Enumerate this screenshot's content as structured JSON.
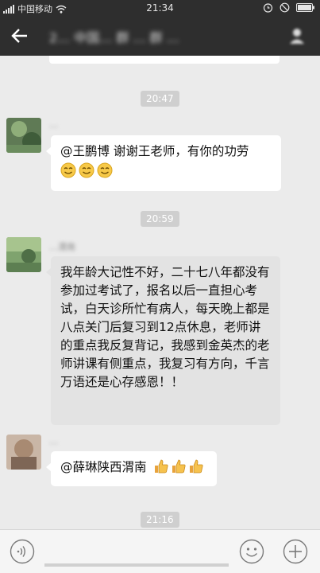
{
  "status_bar": {
    "carrier": "中国移动",
    "time": "21:34",
    "icons": [
      "signal-icon",
      "wifi-icon",
      "alarm-icon",
      "mute-icon",
      "battery-icon"
    ]
  },
  "header": {
    "title": "2… 中国… 群 … 群 …",
    "back_icon": "back-arrow-icon",
    "right_icon": "group-info-icon"
  },
  "messages": [
    {
      "time": "20:47",
      "sender": "…",
      "text": "@王鹏博 谢谢王老师，有你的功劳",
      "emojis": [
        "smile-emoji",
        "smile-emoji",
        "smile-emoji"
      ]
    },
    {
      "time": "20:59",
      "sender": "…渭南",
      "text": "我年龄大记性不好，二十七八年都没有参加过考试了，报名以后一直担心考试，白天诊所忙有病人，每天晚上都是八点关门后复习到12点休息，老师讲的重点我反复背记，我感到金英杰的老师讲课有侧重点，我复习有方向，千言万语还是心存感恩！！"
    },
    {
      "sender": "…",
      "text": "@薛琳陕西渭南",
      "emojis": [
        "thumbs-up-emoji",
        "thumbs-up-emoji",
        "thumbs-up-emoji"
      ]
    },
    {
      "time": "21:16"
    }
  ],
  "input_bar": {
    "placeholder": "",
    "voice_icon": "voice-icon",
    "emoji_icon": "emoji-icon",
    "plus_icon": "plus-icon"
  },
  "colors": {
    "header_bg": "#2e2e2e",
    "chat_bg": "#ebebeb",
    "bubble_bg": "#ffffff",
    "time_pill_bg": "#cfcfcf"
  }
}
